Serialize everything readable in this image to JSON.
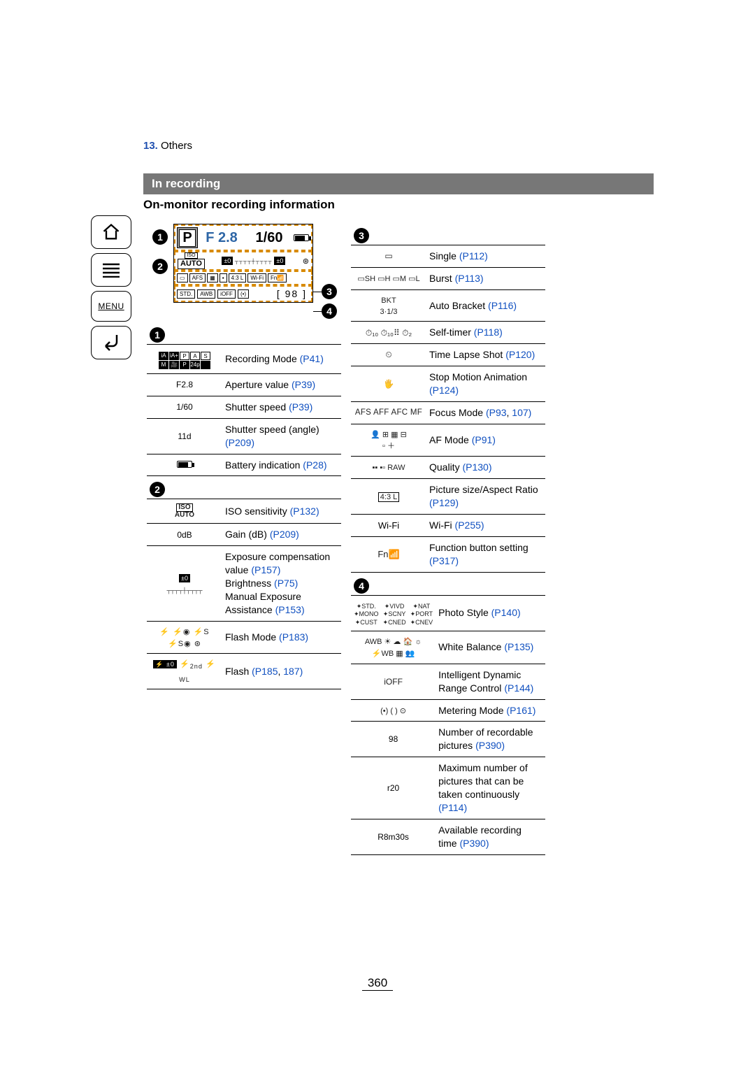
{
  "chapter": {
    "num": "13.",
    "name": "Others"
  },
  "section_title": "In recording",
  "sub_header": "On-monitor recording information",
  "sidebar": {
    "home": "⌂",
    "toc": "≣",
    "menu_label": "MENU",
    "back": "↩"
  },
  "lcd": {
    "mode_letter": "P",
    "aperture": "F 2.8",
    "shutter": "1/60",
    "auto": "AUTO",
    "iso_label": "ISO",
    "ev1": "±0",
    "ev2": "±0",
    "afs": "AFS",
    "wifi": "Wi-Fi",
    "fn": "Fn",
    "std": "STD.",
    "awb": "AWB",
    "ioff": "iOFF",
    "count": "98"
  },
  "markers": {
    "m1": "1",
    "m2": "2",
    "m3": "3",
    "m4": "4"
  },
  "sec1": {
    "rows": [
      {
        "left_kind": "mode-grid",
        "text": "Recording Mode ",
        "links": [
          {
            "t": "(P41)",
            "p": "P41"
          }
        ]
      },
      {
        "left": "F2.8",
        "text": "Aperture value ",
        "links": [
          {
            "t": "(P39)",
            "p": "P39"
          }
        ]
      },
      {
        "left": "1/60",
        "text": "Shutter speed ",
        "links": [
          {
            "t": "(P39)",
            "p": "P39"
          }
        ]
      },
      {
        "left": "11d",
        "text": "Shutter speed (angle) ",
        "links": [
          {
            "t": "(P209)",
            "p": "P209"
          }
        ]
      },
      {
        "left_kind": "batt",
        "text": "Battery indication ",
        "links": [
          {
            "t": "(P28)",
            "p": "P28"
          }
        ]
      }
    ]
  },
  "sec2": {
    "rows": [
      {
        "left_kind": "iso-auto",
        "text": "ISO sensitivity ",
        "links": [
          {
            "t": "(P132)",
            "p": "P132"
          }
        ]
      },
      {
        "left": "0dB",
        "text": "Gain (dB) ",
        "links": [
          {
            "t": "(P209)",
            "p": "P209"
          }
        ]
      },
      {
        "left_kind": "ev-scale",
        "text_multi": [
          {
            "t": "Exposure compensation value ",
            "links": [
              {
                "t": "(P157)",
                "p": "P157"
              }
            ]
          },
          {
            "t": "Brightness ",
            "links": [
              {
                "t": "(P75)",
                "p": "P75"
              }
            ]
          },
          {
            "t": "Manual Exposure Assistance ",
            "links": [
              {
                "t": "(P153)",
                "p": "P153"
              }
            ]
          }
        ]
      },
      {
        "left_kind": "flash-modes",
        "text": "Flash Mode ",
        "links": [
          {
            "t": "(P183)",
            "p": "P183"
          }
        ]
      },
      {
        "left_kind": "flash-set",
        "text": "Flash ",
        "links": [
          {
            "t": "(P185",
            "p": "P185"
          },
          {
            "t": ", "
          },
          {
            "t": "187)",
            "p": "187"
          }
        ]
      }
    ]
  },
  "sec3": {
    "rows": [
      {
        "left_kind": "single",
        "text": "Single ",
        "links": [
          {
            "t": "(P112)",
            "p": "P112"
          }
        ]
      },
      {
        "left_kind": "burst",
        "text": "Burst ",
        "links": [
          {
            "t": "(P113)",
            "p": "P113"
          }
        ]
      },
      {
        "left_kind": "bkt",
        "left": "BKT\n3·1/3",
        "text": "Auto Bracket ",
        "links": [
          {
            "t": "(P116)",
            "p": "P116"
          }
        ]
      },
      {
        "left_kind": "selftimer",
        "text": "Self-timer ",
        "links": [
          {
            "t": "(P118)",
            "p": "P118"
          }
        ]
      },
      {
        "left_kind": "timelapse",
        "text": "Time Lapse Shot ",
        "links": [
          {
            "t": "(P120)",
            "p": "P120"
          }
        ]
      },
      {
        "left_kind": "stopmotion",
        "text": "Stop Motion Animation ",
        "links": [
          {
            "t": "(P124)",
            "p": "P124"
          }
        ]
      },
      {
        "left_kind": "afs",
        "left": "AFS AFF AFC MF",
        "text": "Focus Mode ",
        "links": [
          {
            "t": "(P93",
            "p": "P93"
          },
          {
            "t": ", "
          },
          {
            "t": "107)",
            "p": "107"
          }
        ]
      },
      {
        "left_kind": "afmode",
        "text": "AF Mode ",
        "links": [
          {
            "t": "(P91)",
            "p": "P91"
          }
        ]
      },
      {
        "left_kind": "quality",
        "left": "RAW",
        "text": "Quality ",
        "links": [
          {
            "t": "(P130)",
            "p": "P130"
          }
        ]
      },
      {
        "left_kind": "picsize",
        "text": "Picture size/Aspect Ratio ",
        "links": [
          {
            "t": "(P129)",
            "p": "P129"
          }
        ]
      },
      {
        "left": "Wi-Fi",
        "left_cls": "wifi-lbl",
        "text": "Wi-Fi ",
        "links": [
          {
            "t": "(P255)",
            "p": "P255"
          }
        ]
      },
      {
        "left_kind": "fn",
        "left": "Fn",
        "text": "Function button setting ",
        "links": [
          {
            "t": "(P317)",
            "p": "P317"
          }
        ]
      }
    ]
  },
  "sec4": {
    "rows": [
      {
        "left_kind": "pstyle",
        "text": "Photo Style ",
        "links": [
          {
            "t": "(P140)",
            "p": "P140"
          }
        ]
      },
      {
        "left_kind": "wb",
        "left": "AWB",
        "text": "White Balance ",
        "links": [
          {
            "t": "(P135)",
            "p": "P135"
          }
        ]
      },
      {
        "left_kind": "idr",
        "left": "iOFF",
        "text": "Intelligent Dynamic Range Control ",
        "links": [
          {
            "t": "(P144)",
            "p": "P144"
          }
        ]
      },
      {
        "left_kind": "metering",
        "text": "Metering Mode ",
        "links": [
          {
            "t": "(P161)",
            "p": "P161"
          }
        ]
      },
      {
        "left": "98",
        "text": "Number of recordable pictures ",
        "links": [
          {
            "t": "(P390)",
            "p": "P390"
          }
        ]
      },
      {
        "left": "r20",
        "text": "Maximum number of pictures that can be taken continuously ",
        "links": [
          {
            "t": "(P114)",
            "p": "P114"
          }
        ]
      },
      {
        "left": "R8m30s",
        "text": "Available recording time ",
        "links": [
          {
            "t": "(P390)",
            "p": "P390"
          }
        ]
      }
    ]
  },
  "pstyle_labels": [
    "STD.",
    "VIVD",
    "NAT",
    "MONO",
    "SCNY",
    "PORT",
    "CUST",
    "CNED",
    "CNEV"
  ],
  "page_number": "360"
}
